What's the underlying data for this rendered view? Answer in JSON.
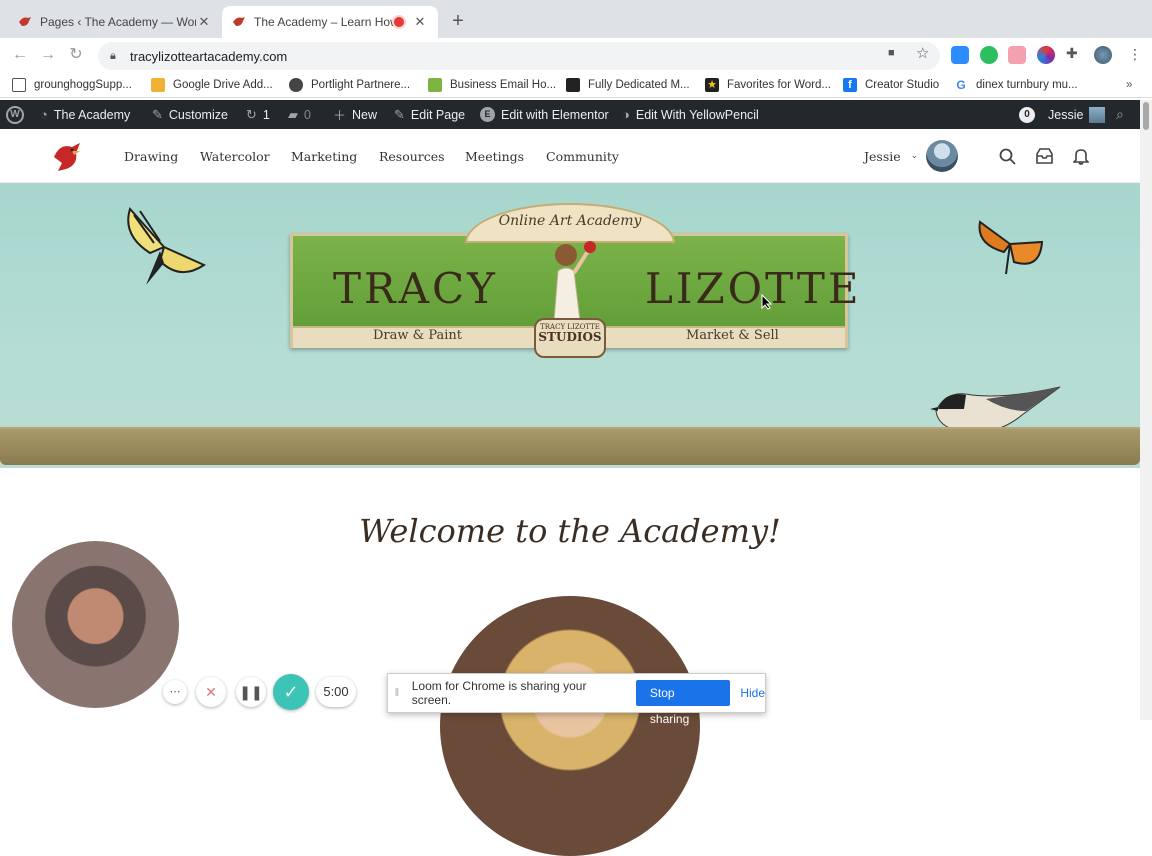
{
  "browser": {
    "tabs": [
      {
        "title": "Pages ‹ The Academy — WordPress",
        "active": false
      },
      {
        "title": "The Academy – Learn How",
        "active": true
      }
    ],
    "url": "tracylizotteartacademy.com",
    "bookmarks": [
      {
        "label": "grounghoggSupp...",
        "icon": "folder-icon"
      },
      {
        "label": "Google Drive Add...",
        "icon": "drive-folder-icon"
      },
      {
        "label": "Portlight Partnere...",
        "icon": "globe-icon"
      },
      {
        "label": "Business Email Ho...",
        "icon": "email-host-icon"
      },
      {
        "label": "Fully Dedicated M...",
        "icon": "fd-icon"
      },
      {
        "label": "Favorites for Word...",
        "icon": "star-favicon-icon"
      },
      {
        "label": "Creator Studio",
        "icon": "facebook-icon"
      },
      {
        "label": "dinex turnbury mu...",
        "icon": "google-icon"
      }
    ]
  },
  "adminbar": {
    "site": "The Academy",
    "customize": "Customize",
    "updates": "1",
    "comments": "0",
    "new": "New",
    "edit_page": "Edit Page",
    "elementor": "Edit with Elementor",
    "yellowpencil": "Edit With YellowPencil",
    "notif_count": "0",
    "user": "Jessie"
  },
  "nav": {
    "items": [
      "Drawing",
      "Watercolor",
      "Marketing",
      "Resources",
      "Meetings",
      "Community"
    ],
    "user": "Jessie"
  },
  "hero": {
    "ribbon": "Online Art Academy",
    "name_left": "TRACY",
    "name_right": "LIZOTTE",
    "tag_left": "Draw & Paint",
    "tag_right": "Market & Sell",
    "seal_top": "TRACY LIZOTTE",
    "seal_bottom": "STUDIOS"
  },
  "welcome": "Welcome to the Academy!",
  "loom": {
    "timer": "5:00",
    "sharing_text": "Loom for Chrome is sharing your screen.",
    "stop_label": "Stop sharing",
    "hide_label": "Hide"
  },
  "colors": {
    "admin_bar": "#23282d",
    "hero_bg": "#a6d6cd",
    "banner_green": "#6aa63c",
    "loom_teal": "#3cc5b6",
    "stop_blue": "#1a73e8"
  }
}
